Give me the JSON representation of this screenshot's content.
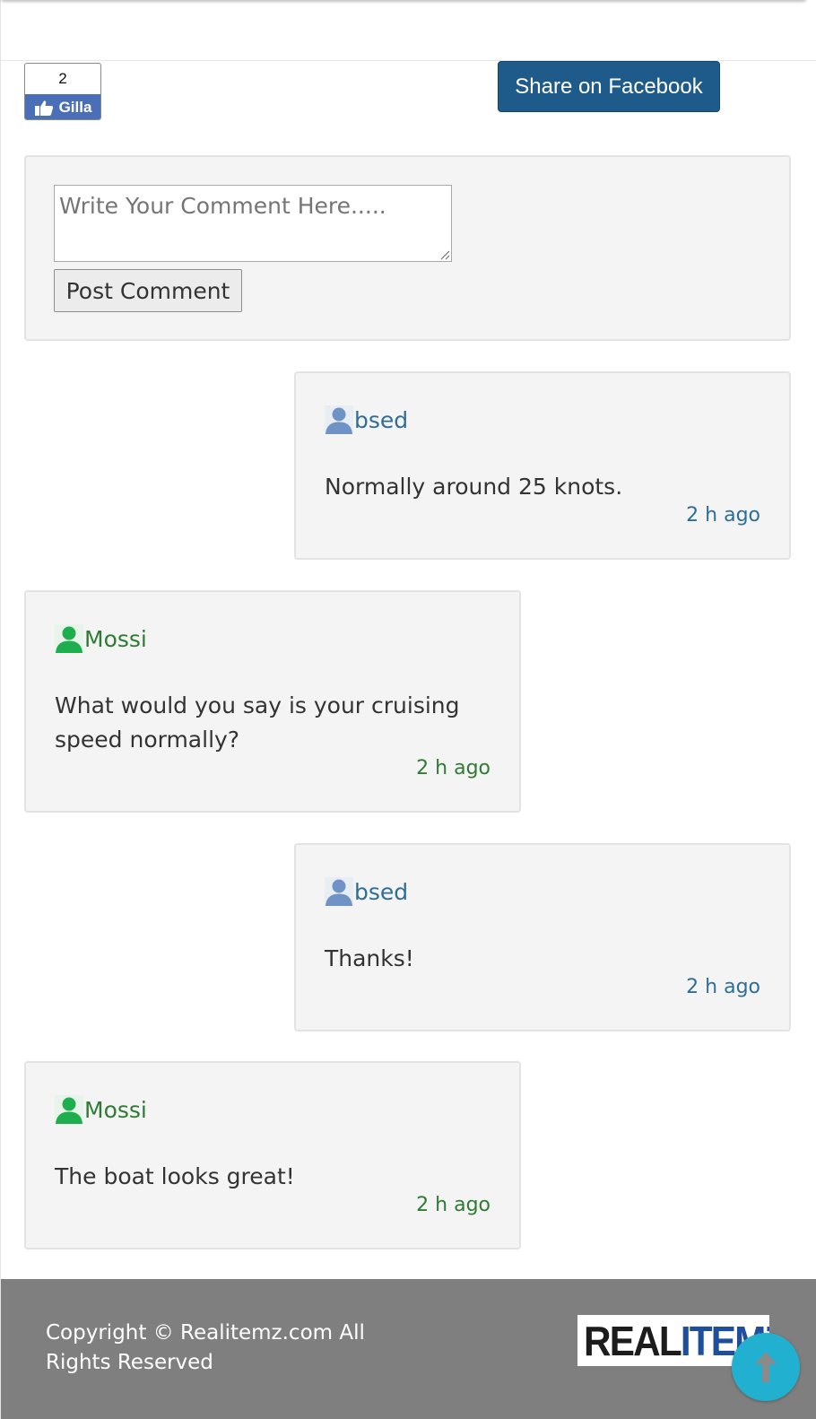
{
  "like_widget": {
    "count": "2",
    "label": "Gilla",
    "icon": "thumbs-up-icon"
  },
  "share": {
    "label": "Share on Facebook"
  },
  "comment_form": {
    "placeholder": "Write Your Comment Here.....",
    "value": "",
    "submit_label": "Post Comment"
  },
  "comments": [
    {
      "author": "bsed",
      "text": "Normally around 25 knots.",
      "time": "2 h ago",
      "side": "right"
    },
    {
      "author": "Mossi",
      "text": "What would you say is your cruising speed normally?",
      "time": "2 h ago",
      "side": "left"
    },
    {
      "author": "bsed",
      "text": "Thanks!",
      "time": "2 h ago",
      "side": "right"
    },
    {
      "author": "Mossi",
      "text": "The boat looks great!",
      "time": "2 h ago",
      "side": "left"
    }
  ],
  "footer": {
    "copyright": "Copyright © Realitemz.com All Rights Reserved",
    "logo_text_dark": "REAL",
    "logo_text_blue": "ITEMZ"
  },
  "colors": {
    "share_button": "#1e5a8a",
    "like_button": "#4a6fb8",
    "author_right": "#2f6e95",
    "author_left": "#2f7b34",
    "footer_bg": "#7f7f7f",
    "scroll_top_button": "#22b0d0"
  },
  "icons": {
    "avatar_right": "user-avatar-blue-icon",
    "avatar_left": "user-avatar-green-icon",
    "scroll_top": "arrow-up-icon"
  }
}
